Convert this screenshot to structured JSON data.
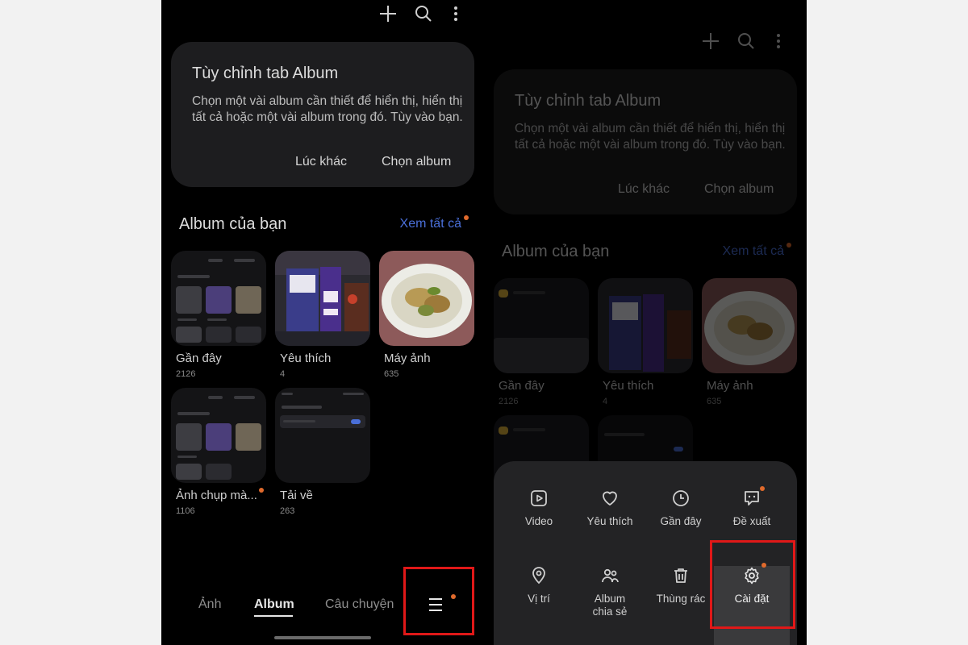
{
  "top_icons": [
    "plus-icon",
    "search-icon",
    "more-vert-icon"
  ],
  "customize_card": {
    "title": "Tùy chỉnh tab Album",
    "description": "Chọn một vài album cần thiết để hiển thị, hiển thị tất cả hoặc một vài album trong đó. Tùy vào bạn.",
    "later_button": "Lúc khác",
    "choose_button": "Chọn album"
  },
  "albums_section": {
    "title": "Album của bạn",
    "see_all": "Xem tất cả"
  },
  "albums": [
    {
      "name": "Gần đây",
      "count": "2126"
    },
    {
      "name": "Yêu thích",
      "count": "4"
    },
    {
      "name": "Máy ảnh",
      "count": "635"
    },
    {
      "name": "Ảnh chụp mà...",
      "count": "1106"
    },
    {
      "name": "Tải về",
      "count": "263"
    }
  ],
  "bottom_nav": {
    "photos": "Ảnh",
    "album": "Album",
    "stories": "Câu chuyện",
    "menu_icon": "hamburger-menu-icon"
  },
  "menu_sheet": {
    "items": [
      {
        "label": "Video",
        "icon": "video-icon"
      },
      {
        "label": "Yêu thích",
        "icon": "heart-icon"
      },
      {
        "label": "Gần đây",
        "icon": "clock-icon"
      },
      {
        "label": "Đề xuất",
        "icon": "suggest-icon"
      },
      {
        "label": "Vị trí",
        "icon": "location-icon"
      },
      {
        "label": "Album chia sẻ",
        "icon": "shared-people-icon"
      },
      {
        "label": "Thùng rác",
        "icon": "trash-icon"
      },
      {
        "label": "Cài đặt",
        "icon": "gear-icon"
      }
    ]
  },
  "colors": {
    "background": "#000000",
    "card": "#1d1d1f",
    "accent_link": "#4a6fd8",
    "badge": "#e06a2c",
    "highlight": "#e01818"
  }
}
